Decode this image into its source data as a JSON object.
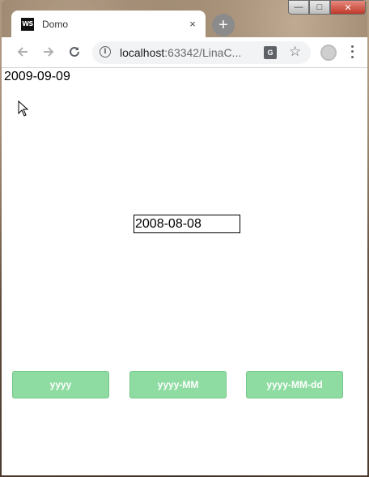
{
  "browser": {
    "tab_title": "Domo",
    "tab_icon_text": "WS",
    "tab_close": "×",
    "new_tab": "+",
    "url_host": "localhost",
    "url_rest": ":63342/LinaC...",
    "menu_icon": "kebab-menu-icon"
  },
  "window_controls": {
    "minimize": "—",
    "maximize": "□",
    "close": "✕"
  },
  "page": {
    "date_text": "2009-09-09",
    "date_input_value": "2008-08-08",
    "buttons": [
      {
        "label": "yyyy"
      },
      {
        "label": "yyyy-MM"
      },
      {
        "label": "yyyy-MM-dd"
      }
    ]
  },
  "colors": {
    "button_bg": "#8fdca2",
    "button_text": "#ffffff"
  }
}
